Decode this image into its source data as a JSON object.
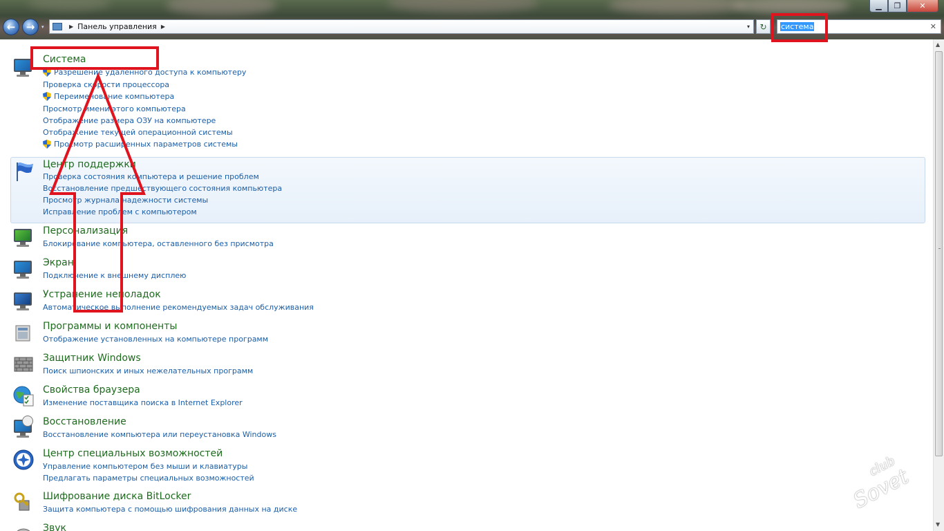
{
  "window": {
    "minimize_glyph": "▁",
    "maximize_glyph": "❐",
    "close_glyph": "✕"
  },
  "nav": {
    "back_glyph": "←",
    "forward_glyph": "→",
    "history_glyph": "▾"
  },
  "address": {
    "separator": "▶",
    "path": "Панель управления",
    "trailing_separator": "▶",
    "dropdown_glyph": "▾",
    "refresh_glyph": "↻"
  },
  "search": {
    "value": "система",
    "clear_glyph": "✕"
  },
  "groups": [
    {
      "title": "Система",
      "icon": "system-monitor-icon",
      "links": [
        {
          "text": "Разрешение удаленного доступа к компьютеру",
          "shield": true
        },
        {
          "text": "Проверка скорости процессора",
          "shield": false
        },
        {
          "text": "Переименование компьютера",
          "shield": true
        },
        {
          "text": "Просмотр имени этого компьютера",
          "shield": false
        },
        {
          "text": "Отображение размера ОЗУ на компьютере",
          "shield": false
        },
        {
          "text": "Отображение текущей операционной системы",
          "shield": false
        },
        {
          "text": "Просмотр расширенных параметров системы",
          "shield": true
        }
      ]
    },
    {
      "title": "Центр поддержки",
      "icon": "flag-icon",
      "highlighted": true,
      "links": [
        {
          "text": "Проверка состояния компьютера и решение проблем"
        },
        {
          "text": "Восстановление предшествующего состояния компьютера"
        },
        {
          "text": "Просмотр журнала надежности системы"
        },
        {
          "text": "Исправление проблем с компьютером"
        }
      ]
    },
    {
      "title": "Персонализация",
      "icon": "personalization-monitor-icon",
      "links": [
        {
          "text": "Блокирование компьютера, оставленного без присмотра"
        }
      ]
    },
    {
      "title": "Экран",
      "icon": "display-monitor-icon",
      "links": [
        {
          "text": "Подключение к внешнему дисплею"
        }
      ]
    },
    {
      "title": "Устранение неполадок",
      "icon": "troubleshooting-monitor-icon",
      "links": [
        {
          "text": "Автоматическое выполнение рекомендуемых задач обслуживания"
        }
      ]
    },
    {
      "title": "Программы и компоненты",
      "icon": "programs-box-icon",
      "links": [
        {
          "text": "Отображение установленных на компьютере программ"
        }
      ]
    },
    {
      "title": "Защитник Windows",
      "icon": "defender-wall-icon",
      "links": [
        {
          "text": "Поиск шпионских и иных нежелательных программ"
        }
      ]
    },
    {
      "title": "Свойства браузера",
      "icon": "globe-checklist-icon",
      "links": [
        {
          "text": "Изменение поставщика поиска в Internet Explorer"
        }
      ]
    },
    {
      "title": "Восстановление",
      "icon": "recovery-monitor-icon",
      "links": [
        {
          "text": "Восстановление компьютера или переустановка Windows"
        }
      ]
    },
    {
      "title": "Центр специальных возможностей",
      "icon": "accessibility-icon",
      "links": [
        {
          "text": "Управление компьютером без мыши и клавиатуры"
        },
        {
          "text": "Предлагать параметры специальных возможностей"
        }
      ]
    },
    {
      "title": "Шифрование диска BitLocker",
      "icon": "bitlocker-keys-icon",
      "links": [
        {
          "text": "Защита компьютера с помощью шифрования данных на диске"
        }
      ]
    },
    {
      "title": "Звук",
      "icon": "sound-icon",
      "links": []
    }
  ],
  "watermark": {
    "line1": "club",
    "line2": "Sovet"
  },
  "colors": {
    "title_green": "#1e6b1e",
    "link_blue": "#1a5ea8",
    "annotation_red": "#e0141e",
    "selection_blue": "#3399ff"
  }
}
